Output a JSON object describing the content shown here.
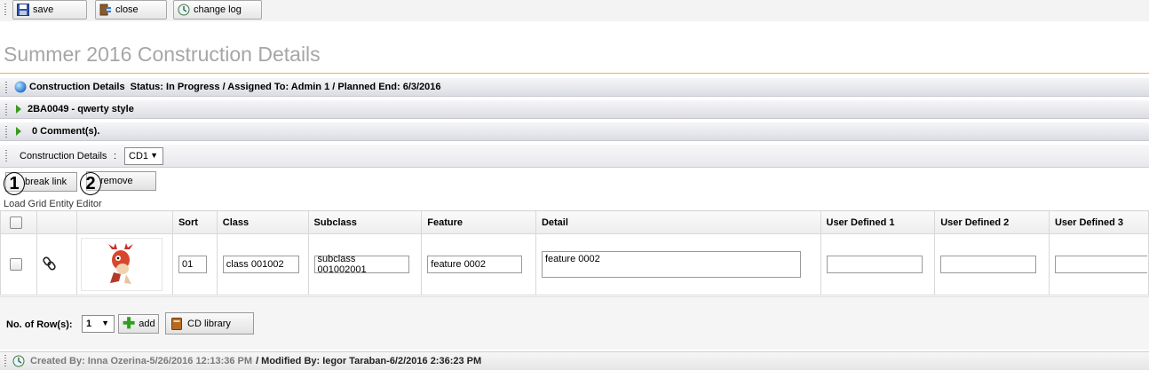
{
  "toolbar": {
    "save_label": "save",
    "close_label": "close",
    "changelog_label": "change log"
  },
  "page_title": "Summer 2016 Construction Details",
  "sections": {
    "details_header": "Construction Details  Status: In Progress / Assigned To: Admin 1 / Planned End: 6/3/2016",
    "style_header": "2BA0049 - qwerty style",
    "comments_header": "0 Comment(s)."
  },
  "cd_selector": {
    "label": "Construction Details",
    "separator": ":",
    "value": "CD1"
  },
  "actions": {
    "break_link_label": "break link",
    "remove_label": "remove",
    "callout_1": "1",
    "callout_2": "2"
  },
  "grid_caption": "Load Grid Entity Editor",
  "grid": {
    "headers": [
      "Sort",
      "Class",
      "Subclass",
      "Feature",
      "Detail",
      "User Defined 1",
      "User Defined 2",
      "User Defined 3"
    ],
    "row": {
      "sort": "01",
      "class": "class 001002",
      "subclass": "subclass 001002001",
      "feature": "feature 0002",
      "detail": "feature 0002",
      "ud1": "",
      "ud2": "",
      "ud3": ""
    }
  },
  "footer_controls": {
    "rows_label": "No. of Row(s):",
    "rows_value": "1",
    "add_label": "add",
    "library_label": "CD library"
  },
  "status": {
    "created_label": "Created By: Inna Ozerina-5/26/2016 12:13:36 PM",
    "modified_label": "/ Modified By: Iegor Taraban-6/2/2016 2:36:23 PM"
  },
  "colors": {
    "title_gray": "#a6a6a6",
    "accent_orange": "#f0b542",
    "add_green": "#2f9e1f"
  }
}
